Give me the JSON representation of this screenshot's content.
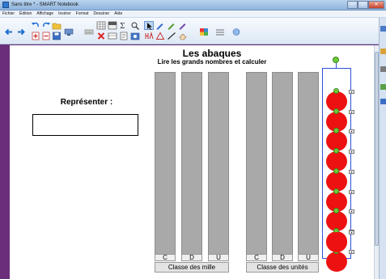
{
  "window": {
    "title": "Sans titre * - SMART Notebook",
    "controls": {
      "minimize": "—",
      "maximize": "□",
      "close": "✕"
    }
  },
  "menu": {
    "items": [
      "Fichier",
      "Édition",
      "Affichage",
      "Insérer",
      "Format",
      "Dessiner",
      "Aide"
    ]
  },
  "toolbar": {
    "icons": [
      "back-arrow-icon",
      "forward-arrow-icon",
      "undo-icon",
      "redo-icon",
      "open-file-icon",
      "add-page-icon",
      "save-icon",
      "screen-icon",
      "keyboard-icon",
      "table-icon",
      "delete-icon",
      "shade-icon",
      "capture-icon",
      "select-icon",
      "pen-icon",
      "highlighter-icon",
      "eraser-icon",
      "line-icon",
      "shape-icon",
      "fill-icon",
      "properties-icon",
      "colors-icon",
      "line-style-icon",
      "transparency-icon"
    ]
  },
  "page": {
    "title": "Les abaques",
    "subtitle": "Lire les grands nombres et calculer",
    "represent_label": "Représenter :"
  },
  "abacus": {
    "columns": [
      "C",
      "D",
      "U",
      "C",
      "D",
      "U"
    ],
    "classes": [
      "Classe des mille",
      "Classe des unités"
    ],
    "selected_column_beads": 9
  },
  "colors": {
    "bead": "#ee1111",
    "rod": "#a9a9a9",
    "selection": "#2f4fd8",
    "handle": "#6ccb3a"
  }
}
